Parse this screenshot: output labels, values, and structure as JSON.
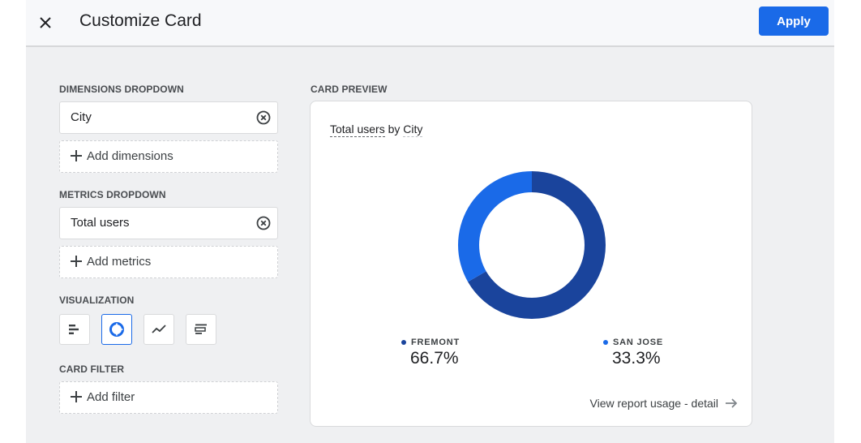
{
  "header": {
    "title": "Customize Card",
    "apply_label": "Apply",
    "close_icon": "close-icon"
  },
  "colors": {
    "accent": "#1a6ae8",
    "fremont": "#1a449c",
    "san_jose": "#1a6ae8"
  },
  "left": {
    "dimensions_label": "DIMENSIONS DROPDOWN",
    "dimension_value": "City",
    "add_dimensions": "Add dimensions",
    "metrics_label": "METRICS DROPDOWN",
    "metric_value": "Total users",
    "add_metrics": "Add metrics",
    "visualization_label": "VISUALIZATION",
    "visualizations": [
      {
        "icon": "bar-chart-icon",
        "selected": false
      },
      {
        "icon": "donut-chart-icon",
        "selected": true
      },
      {
        "icon": "line-chart-icon",
        "selected": false
      },
      {
        "icon": "table-chart-icon",
        "selected": false
      }
    ],
    "filter_label": "CARD FILTER",
    "add_filter": "Add filter"
  },
  "preview": {
    "label": "CARD PREVIEW",
    "title_metric": "Total users",
    "title_by": " by ",
    "title_dimension": "City",
    "view_link": "View report usage - detail"
  },
  "chart_data": {
    "type": "pie",
    "title": "Total users by City",
    "categories": [
      "FREMONT",
      "SAN JOSE"
    ],
    "values": [
      66.7,
      33.3
    ],
    "labels": [
      "66.7%",
      "33.3%"
    ],
    "donut": true,
    "legend": "bottom"
  }
}
